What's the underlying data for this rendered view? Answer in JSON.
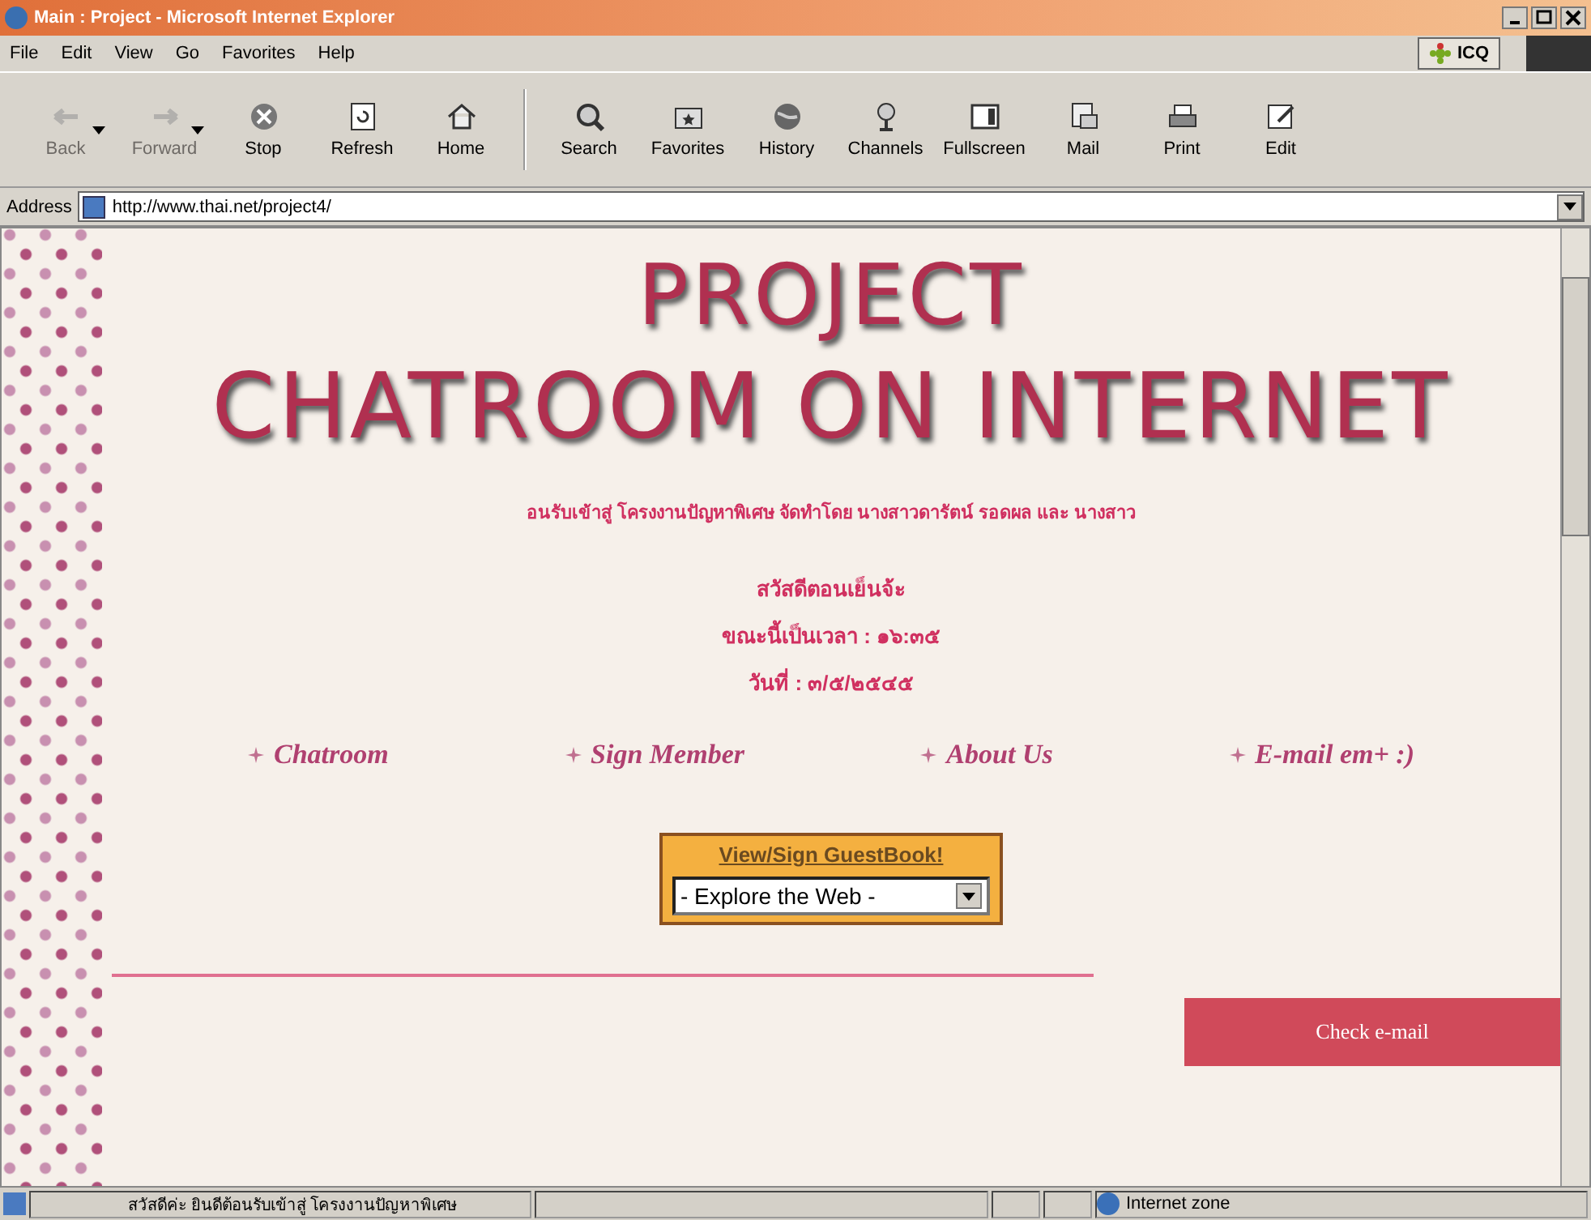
{
  "window": {
    "title": "Main : Project - Microsoft Internet Explorer"
  },
  "menu": [
    "File",
    "Edit",
    "View",
    "Go",
    "Favorites",
    "Help"
  ],
  "icq": {
    "label": "ICQ"
  },
  "toolbar": [
    {
      "label": "Back",
      "kind": "back",
      "disabled": true
    },
    {
      "label": "Forward",
      "kind": "forward",
      "disabled": true
    },
    {
      "label": "Stop",
      "kind": "stop",
      "disabled": false
    },
    {
      "label": "Refresh",
      "kind": "refresh",
      "disabled": false
    },
    {
      "label": "Home",
      "kind": "home",
      "disabled": false
    },
    {
      "label": "Search",
      "kind": "search",
      "disabled": false
    },
    {
      "label": "Favorites",
      "kind": "favorites",
      "disabled": false
    },
    {
      "label": "History",
      "kind": "history",
      "disabled": false
    },
    {
      "label": "Channels",
      "kind": "channels",
      "disabled": false
    },
    {
      "label": "Fullscreen",
      "kind": "fullscreen",
      "disabled": false
    },
    {
      "label": "Mail",
      "kind": "mail",
      "disabled": false
    },
    {
      "label": "Print",
      "kind": "print",
      "disabled": false
    },
    {
      "label": "Edit",
      "kind": "edit",
      "disabled": false
    }
  ],
  "address": {
    "label": "Address",
    "value": "http://www.thai.net/project4/"
  },
  "page": {
    "title_lines": [
      "PROJECT",
      "CHATROOM ON INTERNET"
    ],
    "welcome": "อนรับเข้าสู่ โครงงานปัญหาพิเศษ จัดทำโดย นางสาวดารัตน์ รอดผล และ นางสาว",
    "greeting": "สวัสดีตอนเย็นจ้ะ",
    "time": "ขณะนี้เป็นเวลา : ๑๖:๓๕",
    "date": "วันที่ : ๓/๕/๒๕๔๕",
    "links": [
      "Chatroom",
      "Sign Member",
      "About Us",
      "E-mail em+ :)"
    ],
    "guestbook": "View/Sign GuestBook!",
    "explore": "- Explore the Web -",
    "check_email": "Check e-mail"
  },
  "status_bar": {
    "text": "สวัสดีค่ะ ยินดีต้อนรับเข้าสู่ โครงงานปัญหาพิเศษ",
    "zone": "Internet zone"
  }
}
